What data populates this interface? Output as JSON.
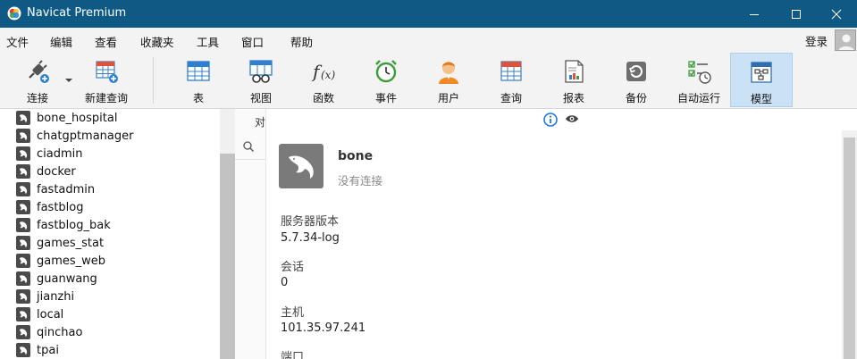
{
  "window": {
    "title": "Navicat Premium"
  },
  "menu": {
    "items": [
      "文件",
      "编辑",
      "查看",
      "收藏夹",
      "工具",
      "窗口",
      "帮助"
    ],
    "login": "登录"
  },
  "toolbar": {
    "connect": "连接",
    "new_query": "新建查询",
    "table": "表",
    "view": "视图",
    "function": "函数",
    "event": "事件",
    "user": "用户",
    "query": "查询",
    "report": "报表",
    "backup": "备份",
    "automation": "自动运行",
    "model": "模型"
  },
  "tree": {
    "databases": [
      "bone_hospital",
      "chatgptmanager",
      "ciadmin",
      "docker",
      "fastadmin",
      "fastblog",
      "fastblog_bak",
      "games_stat",
      "games_web",
      "guanwang",
      "jianzhi",
      "local",
      "qinchao",
      "tpai"
    ]
  },
  "midpane": {
    "tab_text": "对"
  },
  "info": {
    "connection_name": "bone",
    "status": "没有连接",
    "server_version_label": "服务器版本",
    "server_version": "5.7.34-log",
    "session_label": "会话",
    "session": "0",
    "host_label": "主机",
    "host": "101.35.97.241",
    "port_label": "端口"
  },
  "colors": {
    "titlebar": "#0e5a85",
    "active_tool": "#cbe2f6",
    "info_icon": "#1e7ad6"
  }
}
